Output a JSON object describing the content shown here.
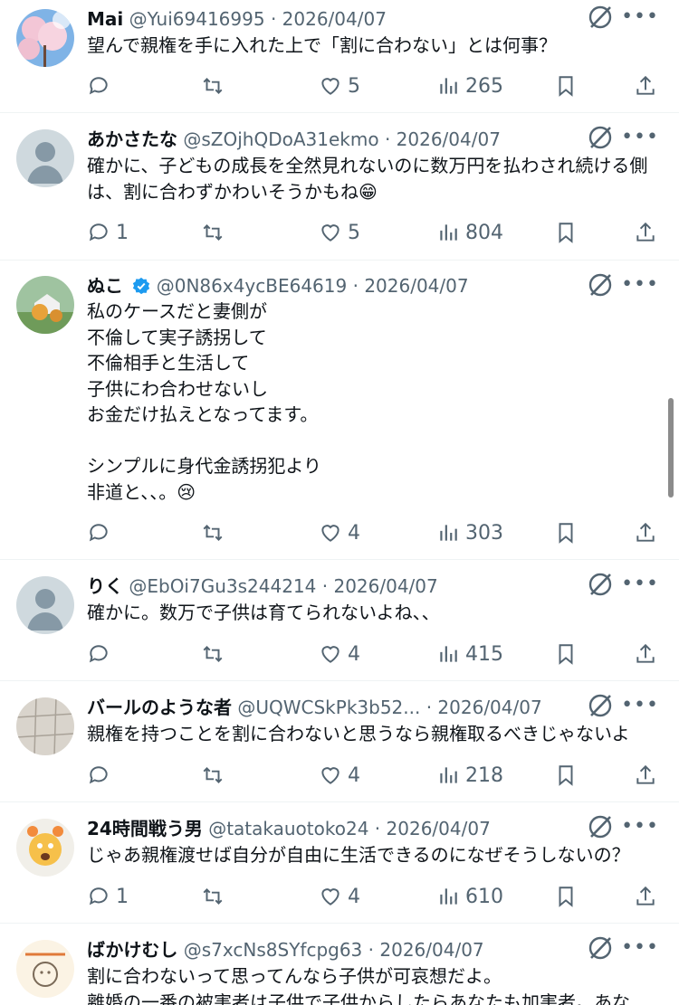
{
  "posts": [
    {
      "name": "Mai",
      "handle": "@Yui69416995",
      "date": "2026/04/07",
      "text": "望んで親権を手に入れた上で「割に合わない」とは何事？",
      "replies": "",
      "likes": "5",
      "views": "265",
      "verified": false
    },
    {
      "name": "あかさたな",
      "handle": "@sZOjhQDoA31ekmo",
      "date": "2026/04/07",
      "text": "確かに、子どもの成長を全然見れないのに数万円を払わされ続ける側は、割に合わずかわいそうかもね😁",
      "replies": "1",
      "likes": "5",
      "views": "804",
      "verified": false
    },
    {
      "name": "ぬこ",
      "handle": "@0N86x4ycBE64619",
      "date": "2026/04/07",
      "text": "私のケースだと妻側が\n不倫して実子誘拐して\n不倫相手と生活して\n子供にわ合わせないし\nお金だけ払えとなってます。\n\nシンプルに身代金誘拐犯より\n非道と、、。😢",
      "replies": "",
      "likes": "4",
      "views": "303",
      "verified": true
    },
    {
      "name": "りく",
      "handle": "@EbOi7Gu3s244214",
      "date": "2026/04/07",
      "text": "確かに。数万で子供は育てられないよね、、",
      "replies": "",
      "likes": "4",
      "views": "415",
      "verified": false
    },
    {
      "name": "バールのような者",
      "handle": "@UQWCSkPk3b52...",
      "date": "2026/04/07",
      "text": "親権を持つことを割に合わないと思うなら親権取るべきじゃないよ",
      "replies": "",
      "likes": "4",
      "views": "218",
      "verified": false
    },
    {
      "name": "24時間戦う男",
      "handle": "@tatakauotoko24",
      "date": "2026/04/07",
      "text": "じゃあ親権渡せば自分が自由に生活できるのになぜそうしないの？",
      "replies": "1",
      "likes": "4",
      "views": "610",
      "verified": false
    },
    {
      "name": "ばかけむし",
      "handle": "@s7xcNs8SYfcpg63",
      "date": "2026/04/07",
      "text": "割に合わないって思ってんなら子供が可哀想だよ。\n離婚の一番の被害者は子供で子供からしたらあなたも加害者。あな",
      "replies": "",
      "likes": "",
      "views": "",
      "verified": false
    }
  ],
  "colors": {
    "text": "#0f1419",
    "secondary": "#536471",
    "divider": "#eff3f4",
    "verified": "#1d9bf0"
  },
  "icons": [
    "reply-icon",
    "retweet-icon",
    "like-icon",
    "views-icon",
    "bookmark-icon",
    "share-icon",
    "grok-icon",
    "more-icon",
    "verified-badge"
  ]
}
